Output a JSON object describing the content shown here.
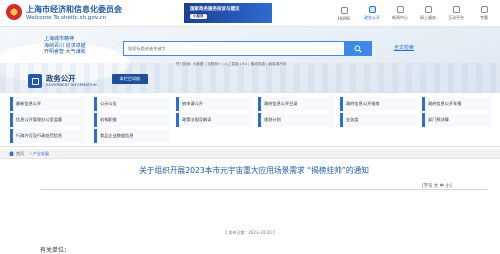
{
  "header": {
    "site_title": "上海市经济和信息化委员会",
    "site_url": "Welcome To sheitc.sh.gov.cn",
    "banner_title": "国家政务服务投诉与建议",
    "banner_sub": "小程序",
    "nav": [
      {
        "label": "HOME",
        "icon": "home-icon",
        "active": false
      },
      {
        "label": "政务公开",
        "icon": "doc-icon",
        "active": true
      },
      {
        "label": "新闻中心",
        "icon": "news-icon",
        "active": false
      },
      {
        "label": "网上服务",
        "icon": "service-icon",
        "active": false
      },
      {
        "label": "互动平台",
        "icon": "chat-icon",
        "active": false
      },
      {
        "label": "专题",
        "icon": "topic-icon",
        "active": false
      }
    ]
  },
  "hero": {
    "city_tag": [
      "上海城市精神",
      "海纳百川 追求卓越",
      "开明睿智 大气谦和"
    ],
    "search_placeholder": "搜索标题或者关键字",
    "full_search": "全文检索",
    "hot_words": "热门搜索: 大数据 | 互联网+ | 人工智能 | 5G | 集成电路 | 新能源汽车",
    "gov_title": "政务公开",
    "gov_sub": "GOVERMENT INFORMATION",
    "guide_btn": "本栏目导航"
  },
  "categories": [
    [
      "最新信息公开",
      "公示公告",
      "依申请公开",
      "政府信息公开目录",
      "政府信息公开指南",
      "政府信息公开年报"
    ],
    [
      "信息公开管理办公室监督",
      "机构职能",
      "政策法规及解读",
      "规划计划",
      "业务类",
      "部门预决算"
    ],
    [
      "行政许可及行政处罚信息",
      "食品企业数据信息",
      "",
      "",
      "",
      ""
    ]
  ],
  "breadcrumb": {
    "home": "首页",
    "sep": ">",
    "current": "产业发展"
  },
  "article": {
    "title": "关于组织开展2023本市元宇宙重大应用场景需求 “揭榜挂帅”的通知",
    "font_size_label": "[字号 大 中 小]",
    "pub_date": "【 发布日期：2023-10-20 】",
    "salutation": "有关单位："
  }
}
